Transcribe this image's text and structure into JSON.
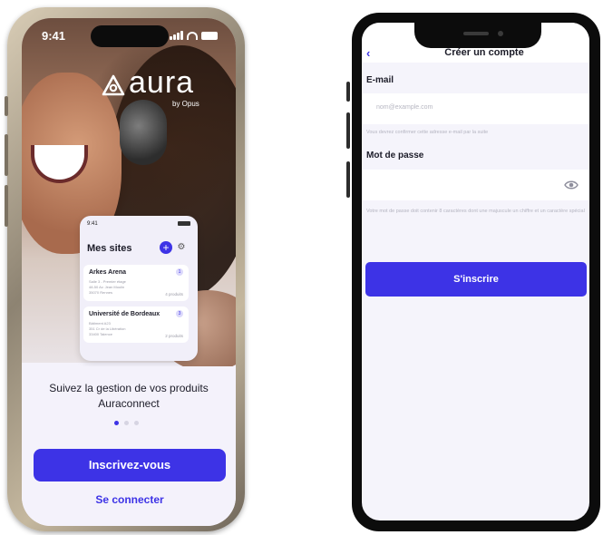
{
  "colors": {
    "brand": "#3d33e6",
    "text": "#1c1c28",
    "muted": "#b4b4c0",
    "screen_bg": "#f5f4fb"
  },
  "left_phone": {
    "status": {
      "time": "9:41"
    },
    "logo": {
      "name": "aura",
      "subtitle": "by Opus"
    },
    "preview": {
      "time": "9:41",
      "title": "Mes sites",
      "sites": [
        {
          "name": "Arkes Arena",
          "line1": "Salle 3 - Premier étage",
          "line2": "48-50 Av. Jean Moulin",
          "line3": "35070 Rennes",
          "count": "4 produits",
          "badge": "1"
        },
        {
          "name": "Université de Bordeaux",
          "line1": "Bâtiment A23",
          "line2": "351 Cr de la Libération",
          "line3": "33400 Talence",
          "count": "2 produits",
          "badge": "3"
        }
      ]
    },
    "tagline": "Suivez la gestion de vos produits Auraconnect",
    "carousel": {
      "count": 3,
      "active": 1
    },
    "register_label": "Inscrivez-vous",
    "login_label": "Se connecter"
  },
  "right_phone": {
    "back_icon": "chevron-left",
    "title": "Créer un compte",
    "email": {
      "label": "E-mail",
      "placeholder": "nom@example.com",
      "help": "Vous devrez confirmer cette adresse e-mail par la suite"
    },
    "password": {
      "label": "Mot de passe",
      "placeholder": "",
      "help": "Votre mot de passe doit contenir 8 caractères dont une majuscule un chiffre et un caractère spécial",
      "visibility_icon": "eye"
    },
    "submit_label": "S'inscrire"
  }
}
